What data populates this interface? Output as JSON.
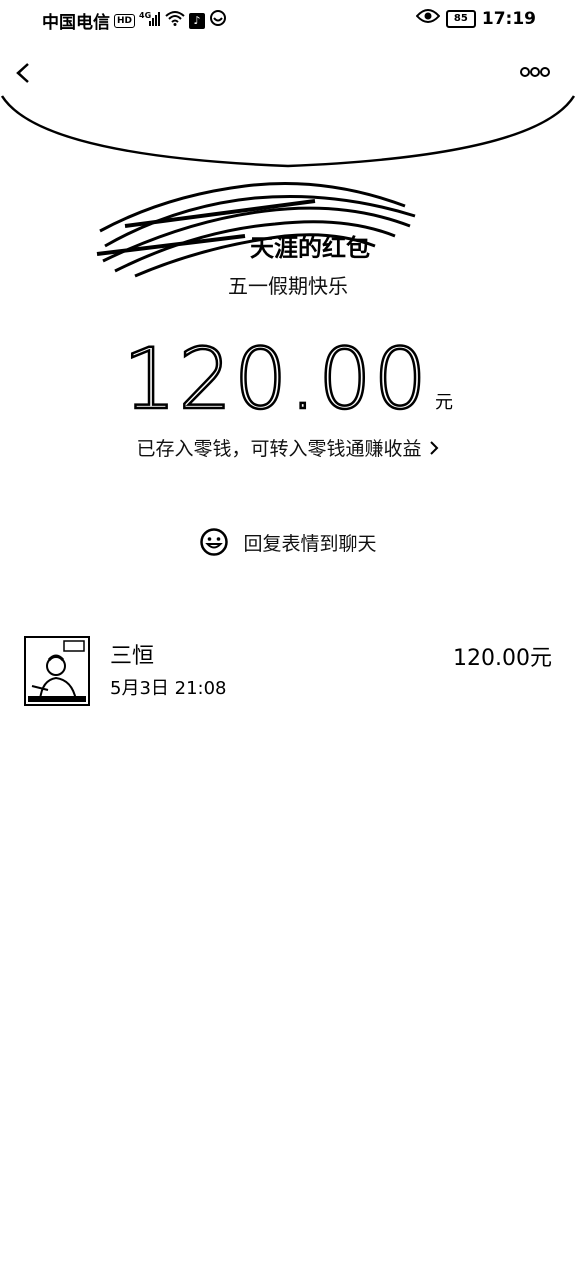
{
  "status_bar": {
    "carrier": "中国电信",
    "hd": "HD",
    "signal": "4G",
    "battery": "85",
    "time": "17:19"
  },
  "header": {
    "back_icon": "chevron-left-icon",
    "more_icon": "more-dots-icon"
  },
  "packet": {
    "sender_title": "天涯的红包",
    "greeting": "五一假期快乐",
    "amount": "120.00",
    "unit": "元",
    "saved_note": "已存入零钱，可转入零钱通赚收益",
    "reply_label": "回复表情到聊天"
  },
  "records": [
    {
      "name": "三恒",
      "time": "5月3日  21:08",
      "amount": "120.00元"
    }
  ]
}
